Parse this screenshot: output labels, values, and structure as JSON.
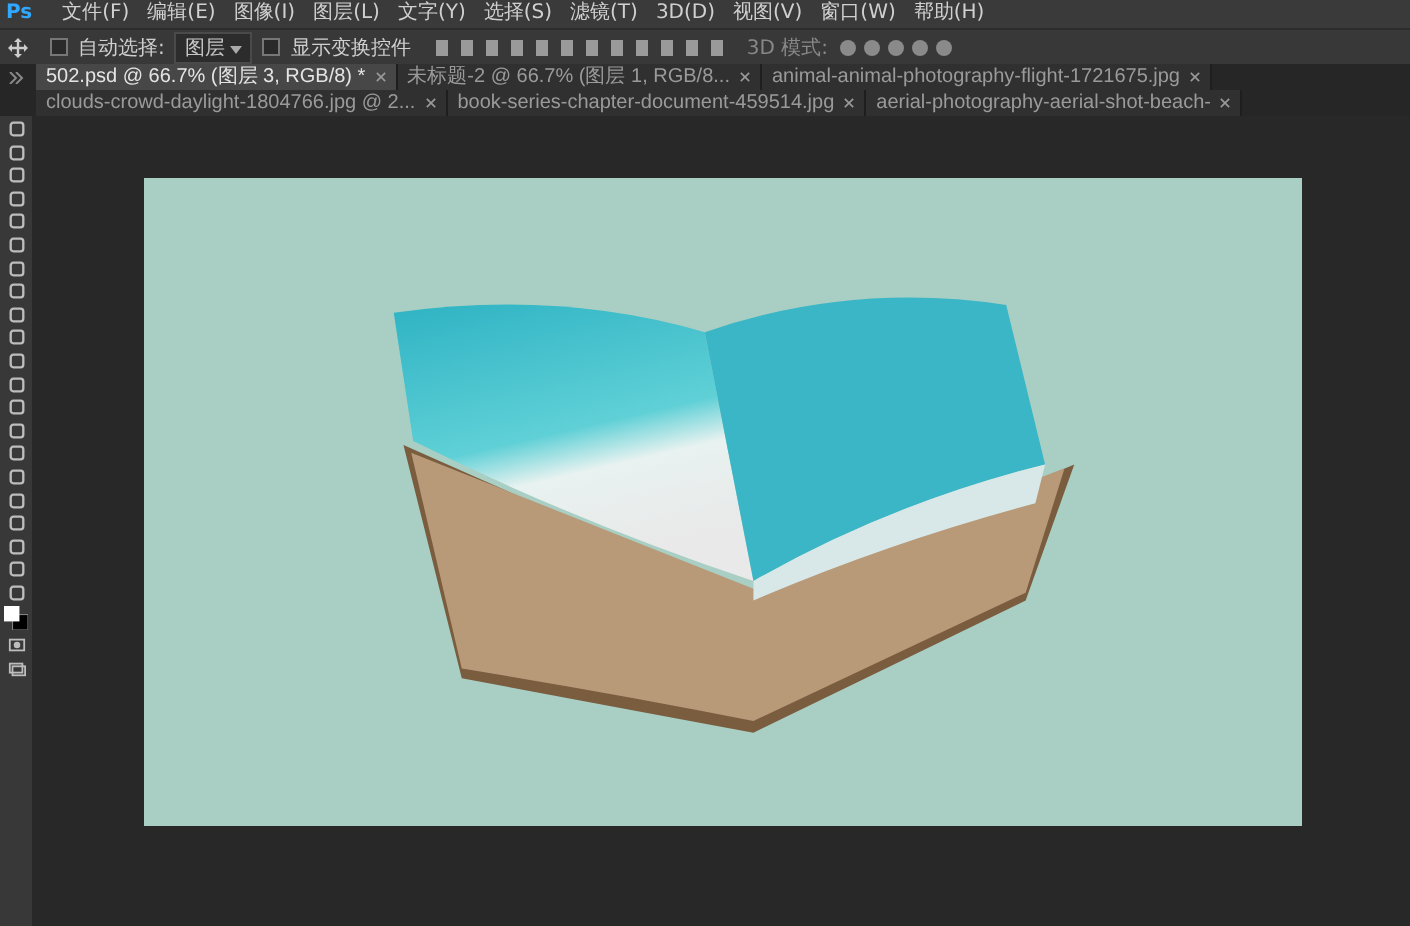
{
  "app": {
    "logo": "Ps"
  },
  "menu": [
    "文件(F)",
    "编辑(E)",
    "图像(I)",
    "图层(L)",
    "文字(Y)",
    "选择(S)",
    "滤镜(T)",
    "3D(D)",
    "视图(V)",
    "窗口(W)",
    "帮助(H)"
  ],
  "options_bar": {
    "auto_select": {
      "label": "自动选择:",
      "checked": false
    },
    "target": {
      "value": "图层"
    },
    "show_transform": {
      "label": "显示变换控件",
      "checked": false
    },
    "mode_label": "3D 模式:"
  },
  "tabs": [
    {
      "label": "502.psd @ 66.7% (图层 3, RGB/8) *",
      "selected": true
    },
    {
      "label": "未标题-2 @ 66.7% (图层 1, RGB/8...",
      "selected": false
    },
    {
      "label": "animal-animal-photography-flight-1721675.jpg",
      "selected": false
    },
    {
      "label": "clouds-crowd-daylight-1804766.jpg @ 2...",
      "selected": false
    },
    {
      "label": "book-series-chapter-document-459514.jpg",
      "selected": false
    },
    {
      "label": "aerial-photography-aerial-shot-beach-",
      "selected": false
    }
  ]
}
